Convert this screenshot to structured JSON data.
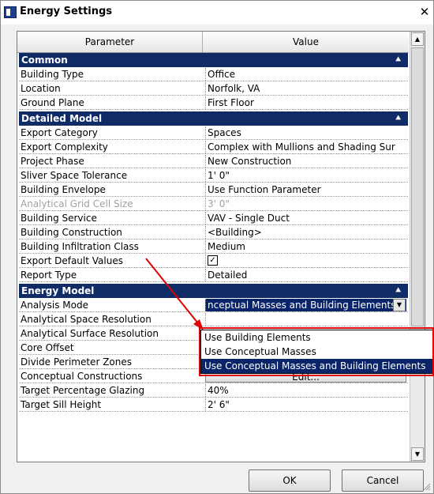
{
  "window": {
    "title": "Energy Settings",
    "close_glyph": "✕"
  },
  "header": {
    "param": "Parameter",
    "value": "Value"
  },
  "sections": [
    {
      "name": "Common",
      "rows": [
        {
          "k": "Building Type",
          "v": "Office"
        },
        {
          "k": "Location",
          "v": "Norfolk, VA"
        },
        {
          "k": "Ground Plane",
          "v": "First Floor"
        }
      ]
    },
    {
      "name": "Detailed Model",
      "rows": [
        {
          "k": "Export Category",
          "v": "Spaces"
        },
        {
          "k": "Export Complexity",
          "v": "Complex with Mullions and Shading Sur"
        },
        {
          "k": "Project Phase",
          "v": "New Construction"
        },
        {
          "k": "Sliver Space Tolerance",
          "v": "1'  0\""
        },
        {
          "k": "Building Envelope",
          "v": "Use Function Parameter"
        },
        {
          "k": "Analytical Grid Cell Size",
          "v": "3'  0\""
        },
        {
          "k": "Building Service",
          "v": "VAV - Single Duct"
        },
        {
          "k": "Building Construction",
          "v": "<Building>"
        },
        {
          "k": "Building Infiltration Class",
          "v": "Medium"
        },
        {
          "k": "Export Default Values",
          "v": "☑"
        },
        {
          "k": "Report Type",
          "v": "Detailed"
        }
      ]
    },
    {
      "name": "Energy Model",
      "rows": [
        {
          "k": "Analysis Mode",
          "v": "nceptual Masses and Building Elements"
        },
        {
          "k": "Analytical Space Resolution",
          "v": ""
        },
        {
          "k": "Analytical Surface Resolution",
          "v": ""
        },
        {
          "k": "Core Offset",
          "v": ""
        },
        {
          "k": "Divide Perimeter Zones",
          "v": "☑"
        },
        {
          "k": "Conceptual Constructions",
          "v": "Edit..."
        },
        {
          "k": "Target Percentage Glazing",
          "v": "40%"
        },
        {
          "k": "Target Sill Height",
          "v": "2'  6\""
        }
      ]
    }
  ],
  "dropdown": {
    "options": [
      "Use Building Elements",
      "Use Conceptual Masses",
      "Use Conceptual Masses and Building Elements"
    ],
    "selected": "Use Conceptual Masses and Building Elements"
  },
  "buttons": {
    "ok": "OK",
    "cancel": "Cancel"
  },
  "icons": {
    "collapse": "chevron-up-icon",
    "scroll_up": "▲",
    "scroll_down": "▼",
    "combo": "▼"
  },
  "colors": {
    "section_header": "#0f2c67",
    "selection": "#0a246a",
    "annotation": "#e00000"
  }
}
